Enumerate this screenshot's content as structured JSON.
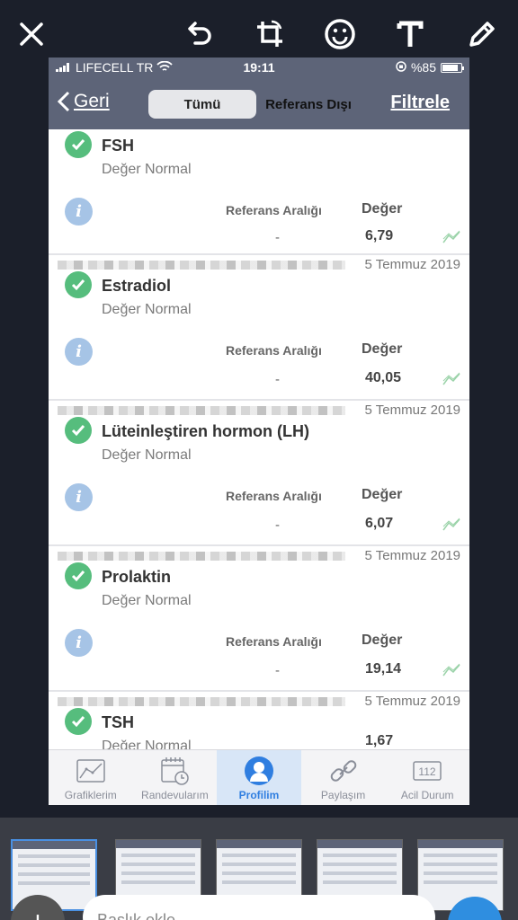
{
  "editor": {
    "tools": [
      "close-icon",
      "undo-icon",
      "crop-rotate-icon",
      "emoji-icon",
      "text-icon",
      "pen-icon"
    ]
  },
  "status_bar": {
    "carrier": "LIFECELL TR",
    "time": "19:11",
    "battery": "%85",
    "battery_level": 0.85
  },
  "nav": {
    "back": "Geri",
    "seg_all": "Tümü",
    "seg_out": "Referans Dışı",
    "filter": "Filtrele"
  },
  "results": [
    {
      "name": "FSH",
      "status": "Değer Normal",
      "ref_label": "Referans Aralığı",
      "ref": "-",
      "val_label": "Değer",
      "value": "6,79",
      "date": ""
    },
    {
      "name": "Estradiol",
      "status": "Değer Normal",
      "ref_label": "Referans Aralığı",
      "ref": "-",
      "val_label": "Değer",
      "value": "40,05",
      "date": "5 Temmuz 2019"
    },
    {
      "name": "Lüteinleştiren hormon (LH)",
      "status": "Değer Normal",
      "ref_label": "Referans Aralığı",
      "ref": "-",
      "val_label": "Değer",
      "value": "6,07",
      "date": "5 Temmuz 2019"
    },
    {
      "name": "Prolaktin",
      "status": "Değer Normal",
      "ref_label": "Referans Aralığı",
      "ref": "-",
      "val_label": "Değer",
      "value": "19,14",
      "date": "5 Temmuz 2019"
    },
    {
      "name": "TSH",
      "status": "Değer Normal",
      "value": "1,67",
      "date": "5 Temmuz 2019"
    }
  ],
  "tabs": [
    {
      "label": "Grafiklerim",
      "icon": "chart-icon"
    },
    {
      "label": "Randevularım",
      "icon": "calendar-icon"
    },
    {
      "label": "Profilim",
      "icon": "profile-icon"
    },
    {
      "label": "Paylaşım",
      "icon": "link-icon"
    },
    {
      "label": "Acil Durum",
      "icon": "emergency-112-icon",
      "badge": "112"
    }
  ],
  "bottom": {
    "caption_placeholder": "Başlık ekle...",
    "add": "+"
  },
  "colors": {
    "header": "#5d6478",
    "check": "#56bd7d",
    "info": "#a6c4e6",
    "active_tab": "#2f7ee0"
  }
}
